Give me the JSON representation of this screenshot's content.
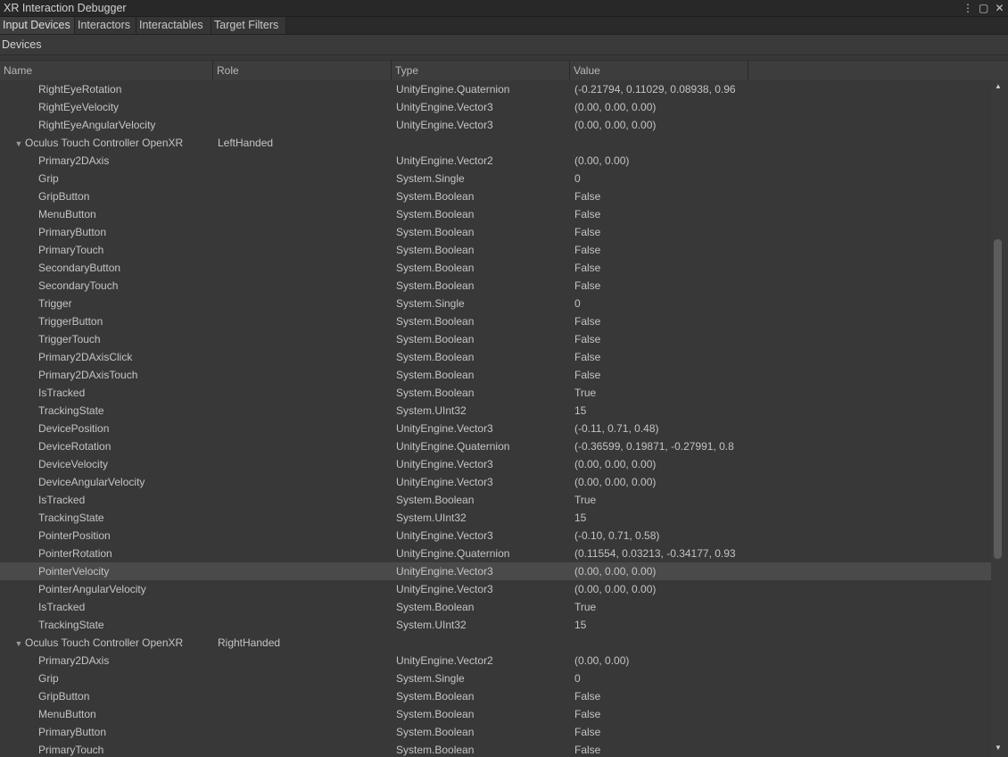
{
  "window": {
    "title": "XR Interaction Debugger"
  },
  "tabs": [
    {
      "label": "Input Devices",
      "active": true
    },
    {
      "label": "Interactors",
      "active": false
    },
    {
      "label": "Interactables",
      "active": false
    },
    {
      "label": "Target Filters",
      "active": false
    }
  ],
  "section": {
    "label": "Devices"
  },
  "columns": {
    "name": "Name",
    "role": "Role",
    "type": "Type",
    "value": "Value"
  },
  "rows": [
    {
      "name": "RightEyeRotation",
      "role": "",
      "type": "UnityEngine.Quaternion",
      "value": "(-0.21794, 0.11029, 0.08938, 0.96"
    },
    {
      "name": "RightEyeVelocity",
      "role": "",
      "type": "UnityEngine.Vector3",
      "value": "(0.00, 0.00, 0.00)"
    },
    {
      "name": "RightEyeAngularVelocity",
      "role": "",
      "type": "UnityEngine.Vector3",
      "value": "(0.00, 0.00, 0.00)"
    },
    {
      "name": "Oculus Touch Controller OpenXR",
      "role": "LeftHanded",
      "type": "",
      "value": "",
      "device": true
    },
    {
      "name": "Primary2DAxis",
      "role": "",
      "type": "UnityEngine.Vector2",
      "value": "(0.00, 0.00)"
    },
    {
      "name": "Grip",
      "role": "",
      "type": "System.Single",
      "value": "0"
    },
    {
      "name": "GripButton",
      "role": "",
      "type": "System.Boolean",
      "value": "False"
    },
    {
      "name": "MenuButton",
      "role": "",
      "type": "System.Boolean",
      "value": "False"
    },
    {
      "name": "PrimaryButton",
      "role": "",
      "type": "System.Boolean",
      "value": "False"
    },
    {
      "name": "PrimaryTouch",
      "role": "",
      "type": "System.Boolean",
      "value": "False"
    },
    {
      "name": "SecondaryButton",
      "role": "",
      "type": "System.Boolean",
      "value": "False"
    },
    {
      "name": "SecondaryTouch",
      "role": "",
      "type": "System.Boolean",
      "value": "False"
    },
    {
      "name": "Trigger",
      "role": "",
      "type": "System.Single",
      "value": "0"
    },
    {
      "name": "TriggerButton",
      "role": "",
      "type": "System.Boolean",
      "value": "False"
    },
    {
      "name": "TriggerTouch",
      "role": "",
      "type": "System.Boolean",
      "value": "False"
    },
    {
      "name": "Primary2DAxisClick",
      "role": "",
      "type": "System.Boolean",
      "value": "False"
    },
    {
      "name": "Primary2DAxisTouch",
      "role": "",
      "type": "System.Boolean",
      "value": "False"
    },
    {
      "name": "IsTracked",
      "role": "",
      "type": "System.Boolean",
      "value": "True"
    },
    {
      "name": "TrackingState",
      "role": "",
      "type": "System.UInt32",
      "value": "15"
    },
    {
      "name": "DevicePosition",
      "role": "",
      "type": "UnityEngine.Vector3",
      "value": "(-0.11, 0.71, 0.48)"
    },
    {
      "name": "DeviceRotation",
      "role": "",
      "type": "UnityEngine.Quaternion",
      "value": "(-0.36599, 0.19871, -0.27991, 0.8"
    },
    {
      "name": "DeviceVelocity",
      "role": "",
      "type": "UnityEngine.Vector3",
      "value": "(0.00, 0.00, 0.00)"
    },
    {
      "name": "DeviceAngularVelocity",
      "role": "",
      "type": "UnityEngine.Vector3",
      "value": "(0.00, 0.00, 0.00)"
    },
    {
      "name": "IsTracked",
      "role": "",
      "type": "System.Boolean",
      "value": "True"
    },
    {
      "name": "TrackingState",
      "role": "",
      "type": "System.UInt32",
      "value": "15"
    },
    {
      "name": "PointerPosition",
      "role": "",
      "type": "UnityEngine.Vector3",
      "value": "(-0.10, 0.71, 0.58)"
    },
    {
      "name": "PointerRotation",
      "role": "",
      "type": "UnityEngine.Quaternion",
      "value": "(0.11554, 0.03213, -0.34177, 0.93"
    },
    {
      "name": "PointerVelocity",
      "role": "",
      "type": "UnityEngine.Vector3",
      "value": "(0.00, 0.00, 0.00)",
      "selected": true
    },
    {
      "name": "PointerAngularVelocity",
      "role": "",
      "type": "UnityEngine.Vector3",
      "value": "(0.00, 0.00, 0.00)"
    },
    {
      "name": "IsTracked",
      "role": "",
      "type": "System.Boolean",
      "value": "True"
    },
    {
      "name": "TrackingState",
      "role": "",
      "type": "System.UInt32",
      "value": "15"
    },
    {
      "name": "Oculus Touch Controller OpenXR",
      "role": "RightHanded",
      "type": "",
      "value": "",
      "device": true
    },
    {
      "name": "Primary2DAxis",
      "role": "",
      "type": "UnityEngine.Vector2",
      "value": "(0.00, 0.00)"
    },
    {
      "name": "Grip",
      "role": "",
      "type": "System.Single",
      "value": "0"
    },
    {
      "name": "GripButton",
      "role": "",
      "type": "System.Boolean",
      "value": "False"
    },
    {
      "name": "MenuButton",
      "role": "",
      "type": "System.Boolean",
      "value": "False"
    },
    {
      "name": "PrimaryButton",
      "role": "",
      "type": "System.Boolean",
      "value": "False"
    },
    {
      "name": "PrimaryTouch",
      "role": "",
      "type": "System.Boolean",
      "value": "False"
    }
  ],
  "icons": {
    "menu": "kebab-menu-icon",
    "maximize": "maximize-icon",
    "close": "close-icon",
    "expand": "triangle-down-icon",
    "scroll_up": "scroll-up-arrow-icon",
    "scroll_down": "scroll-down-arrow-icon"
  },
  "colors": {
    "background": "#383838",
    "selected_row": "#4a4a4a",
    "text": "#c4c4c4"
  }
}
